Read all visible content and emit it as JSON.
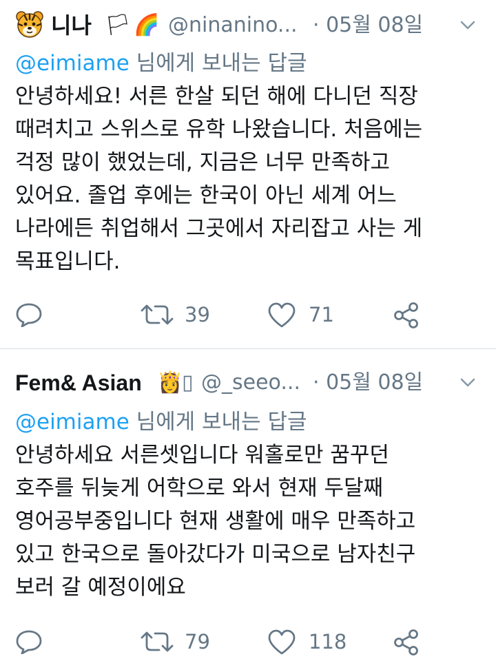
{
  "tweets": [
    {
      "name": "니나",
      "emojis": [
        "🏳",
        "🌈"
      ],
      "handle": "@ninanino...",
      "date": "· 05월 08일",
      "reply_mention": "@eimiame",
      "reply_suffix": " 님에게 보내는 답글",
      "lines": [
        "안녕하세요! 서른 한살 되던 해에 다니던 직장",
        "때려치고 스위스로 유학 나왔습니다. 처음에는",
        "걱정 많이 했었는데, 지금은 너무 만족하고",
        "있어요. 졸업 후에는 한국이 아닌 세계 어느",
        "나라에든 취업해서 그곳에서 자리잡고 사는 게",
        "목표입니다."
      ],
      "retweets": "39",
      "likes": "71"
    },
    {
      "name": "Fem& Asian",
      "emojis": [
        "👸",
        "▯"
      ],
      "handle": "@_seeo...",
      "date": "· 05월 08일",
      "reply_mention": "@eimiame",
      "reply_suffix": " 님에게 보내는 답글",
      "lines": [
        "안녕하세요 서른셋입니다 워홀로만 꿈꾸던",
        "호주를 뒤늦게 어학으로 와서 현재 두달째",
        "영어공부중입니다 현재 생활에 매우 만족하고",
        "있고 한국으로 돌아갔다가 미국으로 남자친구",
        "보러 갈 예정이에요"
      ],
      "retweets": "79",
      "likes": "118"
    }
  ],
  "icons": {
    "avatar_tiger": "tiger-face-icon",
    "caret": "chevron-down-icon",
    "reply": "reply-icon",
    "retweet": "retweet-icon",
    "like": "heart-icon",
    "share": "share-icon"
  },
  "colors": {
    "text": "#14171a",
    "secondary": "#657786",
    "mention": "#1da1f2",
    "divider": "#d8dde2"
  }
}
